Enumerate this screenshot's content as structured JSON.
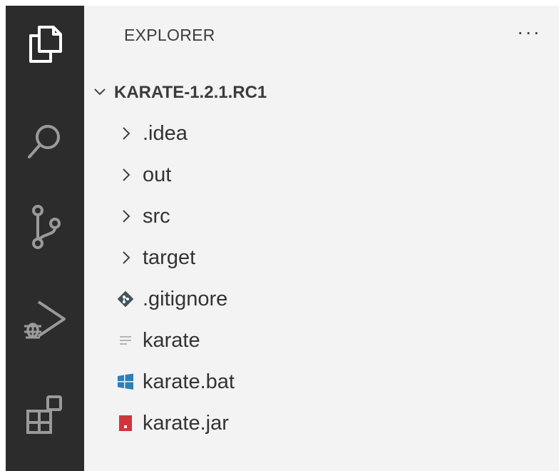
{
  "sidebar": {
    "header": "EXPLORER",
    "more_actions": "···"
  },
  "explorer": {
    "root": {
      "label": "KARATE-1.2.1.RC1",
      "icon": "chevron-down-icon"
    },
    "items": [
      {
        "label": ".idea",
        "kind": "folder",
        "icon": "chevron-right-icon"
      },
      {
        "label": "out",
        "kind": "folder",
        "icon": "chevron-right-icon"
      },
      {
        "label": "src",
        "kind": "folder",
        "icon": "chevron-right-icon"
      },
      {
        "label": "target",
        "kind": "folder",
        "icon": "chevron-right-icon"
      },
      {
        "label": ".gitignore",
        "kind": "file",
        "icon": "git-file-icon"
      },
      {
        "label": "karate",
        "kind": "file",
        "icon": "text-file-icon"
      },
      {
        "label": "karate.bat",
        "kind": "file",
        "icon": "windows-file-icon"
      },
      {
        "label": "karate.jar",
        "kind": "file",
        "icon": "jar-file-icon"
      }
    ]
  },
  "activity_bar": {
    "items": [
      "explorer-icon",
      "search-icon",
      "source-control-icon",
      "run-debug-icon",
      "extensions-icon"
    ]
  },
  "colors": {
    "activity_bar_bg": "#2c2c2c",
    "sidebar_bg": "#f3f3f3",
    "icon_fg": "#cccccc",
    "git_icon": "#41535b",
    "windows_icon": "#2d7fb8",
    "jar_icon": "#d0353a"
  }
}
